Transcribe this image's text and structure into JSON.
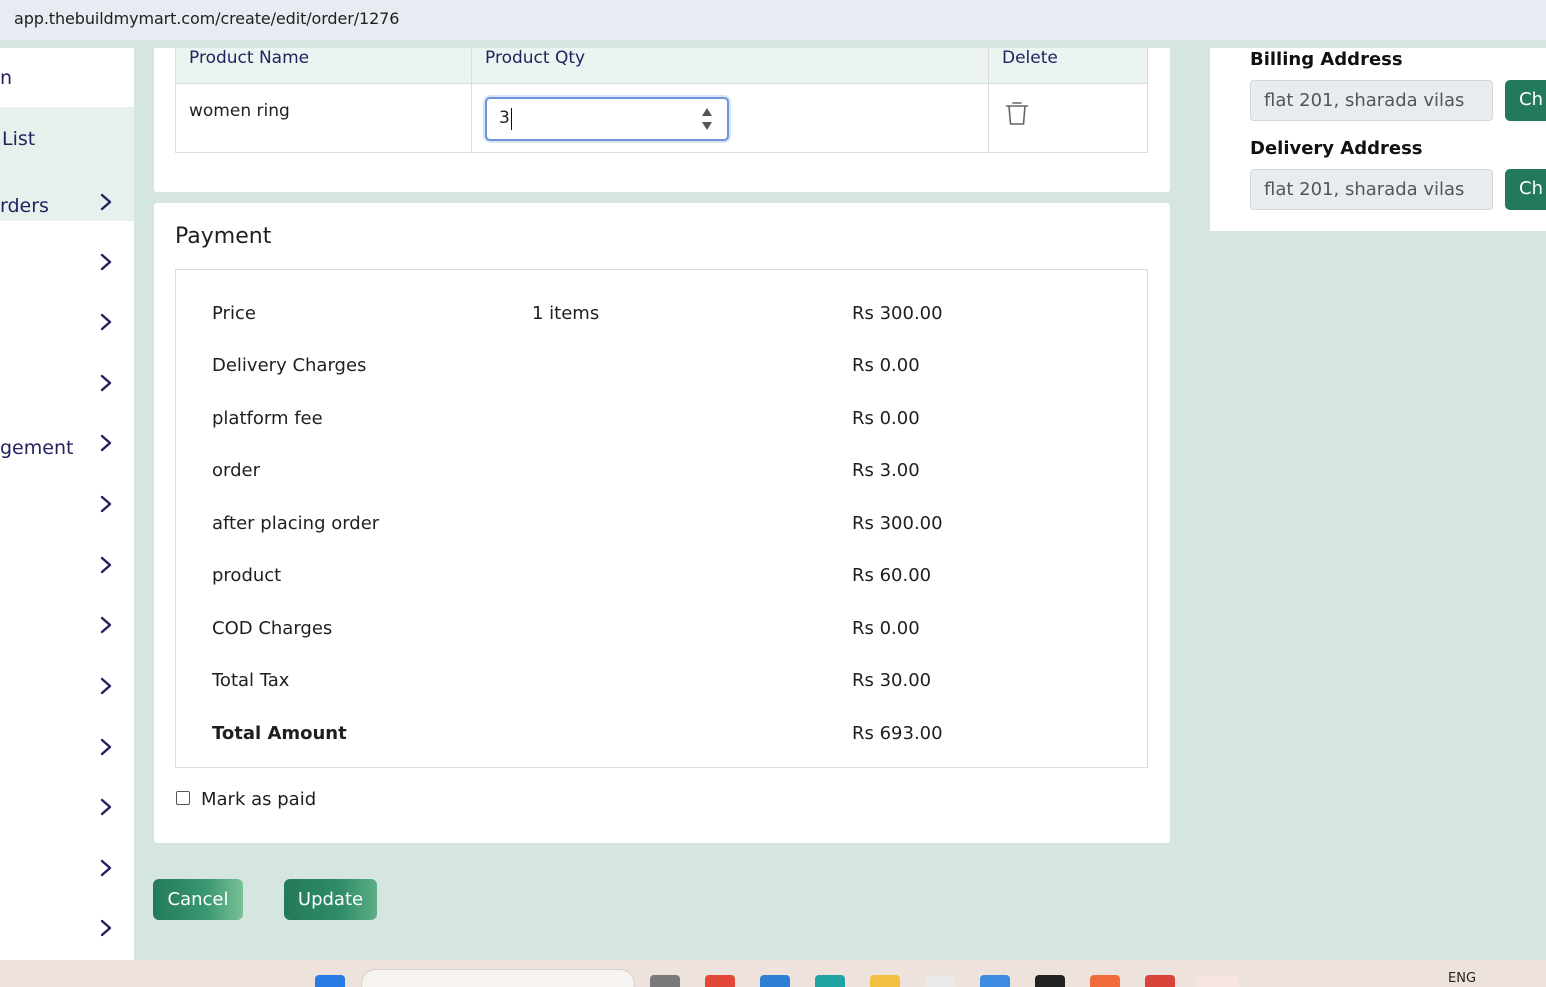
{
  "browser": {
    "url": "app.thebuildmymart.com/create/edit/order/1276"
  },
  "sidebar": {
    "items": [
      {
        "label": "n"
      },
      {
        "label": "List"
      },
      {
        "label": "rders"
      },
      {
        "label": ""
      },
      {
        "label": ""
      },
      {
        "label": ""
      },
      {
        "label": "gement"
      },
      {
        "label": ""
      },
      {
        "label": ""
      },
      {
        "label": ""
      },
      {
        "label": ""
      },
      {
        "label": ""
      },
      {
        "label": ""
      },
      {
        "label": ""
      },
      {
        "label": ""
      }
    ]
  },
  "products": {
    "headers": {
      "name": "Product Name",
      "qty": "Product Qty",
      "delete": "Delete"
    },
    "rows": [
      {
        "name": "women ring",
        "qty": "3"
      }
    ]
  },
  "payment": {
    "title": "Payment",
    "rows": [
      {
        "label": "Price",
        "mid": "1 items",
        "amount": "Rs 300.00"
      },
      {
        "label": "Delivery Charges",
        "mid": "",
        "amount": "Rs 0.00"
      },
      {
        "label": "platform fee",
        "mid": "",
        "amount": "Rs 0.00"
      },
      {
        "label": "order",
        "mid": "",
        "amount": "Rs 3.00"
      },
      {
        "label": "after placing order",
        "mid": "",
        "amount": "Rs 300.00"
      },
      {
        "label": "product",
        "mid": "",
        "amount": "Rs 60.00"
      },
      {
        "label": "COD Charges",
        "mid": "",
        "amount": "Rs 0.00"
      },
      {
        "label": "Total Tax",
        "mid": "",
        "amount": "Rs 30.00"
      },
      {
        "label": "Total Amount",
        "mid": "",
        "amount": "Rs 693.00"
      }
    ],
    "mark_paid_label": "Mark as paid",
    "mark_paid_checked": false
  },
  "actions": {
    "cancel_label": "Cancel",
    "update_label": "Update"
  },
  "addresses": {
    "billing_title": "Billing Address",
    "billing_value": "flat 201, sharada vilas",
    "delivery_title": "Delivery Address",
    "delivery_value": "flat 201, sharada vilas",
    "change_label": "Ch"
  },
  "taskbar": {
    "language": "ENG"
  },
  "colors": {
    "accent_green": "#237a5a",
    "sidebar_text": "#232260",
    "page_background": "#d5e6e0"
  }
}
